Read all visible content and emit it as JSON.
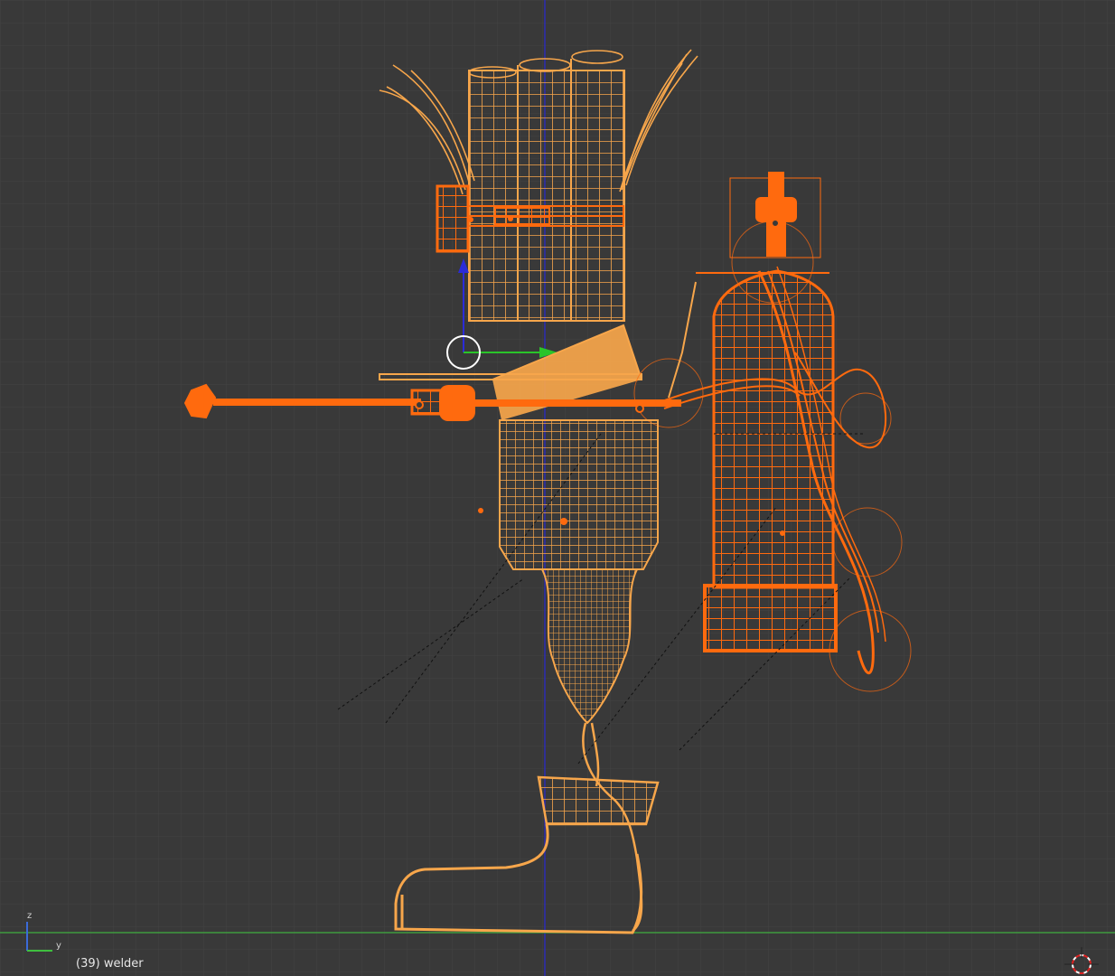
{
  "viewport": {
    "object_info": "(39) welder",
    "axis_widget": {
      "vertical": "z",
      "horizontal": "y"
    },
    "colors": {
      "background": "#393939",
      "grid": "#424242",
      "ground_axis": "#3f9b3f",
      "vertical_axis": "#2c2cb4",
      "selected_wire": "#f7a64b",
      "active_wire": "#ff6a0e"
    }
  }
}
